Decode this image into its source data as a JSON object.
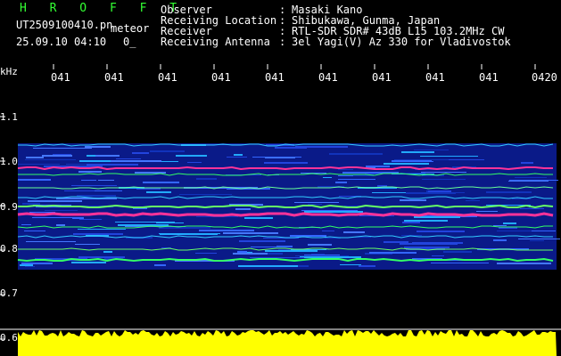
{
  "header": {
    "title": "H R O F F T",
    "filename": "UT2509100410.pn",
    "mode": "meteor",
    "datetime": "25.09.10 04:10",
    "extra": "0_",
    "fields": [
      {
        "label": "Observer",
        "sep": ":",
        "value": "Masaki Kano"
      },
      {
        "label": "Receiving Location",
        "sep": ":",
        "value": "Shibukawa, Gunma, Japan"
      },
      {
        "label": "Receiver",
        "sep": ":",
        "value": "RTL-SDR SDR# 43dB L15 103.2MHz CW"
      },
      {
        "label": "Receiving Antenna",
        "sep": ":",
        "value": "3el Yagi(V) Az 330 for Vladivostok"
      }
    ]
  },
  "axis": {
    "unit": "kHz",
    "y_ticks": [
      {
        "label": "1.1",
        "value": 1.1
      },
      {
        "label": "1.0",
        "value": 1.0
      },
      {
        "label": "0.9",
        "value": 0.9
      },
      {
        "label": "0.8",
        "value": 0.8
      },
      {
        "label": "0.7",
        "value": 0.7
      },
      {
        "label": "0.6",
        "value": 0.6
      }
    ],
    "x_ticks": [
      "041",
      "041",
      "041",
      "041",
      "041",
      "041",
      "041",
      "041",
      "041",
      "0420"
    ]
  },
  "colors": {
    "title": "#33ff33",
    "text": "#ffffff",
    "background": "#000000",
    "noise_band": "#1a33cc",
    "signal_hot": "#ff3399",
    "level_bar": "#ffff00"
  }
}
